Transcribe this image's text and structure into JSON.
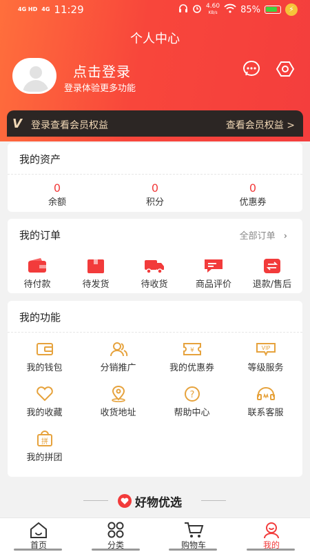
{
  "status_bar": {
    "signal1": "4G HD",
    "signal2": "4G",
    "time": "11:29",
    "net_speed_value": "4.60",
    "net_speed_unit": "KB/s",
    "battery": "85%"
  },
  "header": {
    "title": "个人中心",
    "login_title": "点击登录",
    "login_subtitle": "登录体验更多功能"
  },
  "vip_banner": {
    "logo": "V",
    "text": "登录查看会员权益",
    "link": "查看会员权益 >"
  },
  "assets": {
    "title": "我的资产",
    "items": [
      {
        "value": "0",
        "label": "余额"
      },
      {
        "value": "0",
        "label": "积分"
      },
      {
        "value": "0",
        "label": "优惠券"
      }
    ]
  },
  "orders": {
    "title": "我的订单",
    "all_link": "全部订单",
    "items": [
      {
        "label": "待付款",
        "icon": "wallet-icon"
      },
      {
        "label": "待发货",
        "icon": "package-icon"
      },
      {
        "label": "待收货",
        "icon": "truck-icon"
      },
      {
        "label": "商品评价",
        "icon": "comment-icon"
      },
      {
        "label": "退款/售后",
        "icon": "refund-icon"
      }
    ]
  },
  "functions": {
    "title": "我的功能",
    "items": [
      {
        "label": "我的钱包",
        "icon": "wallet-icon"
      },
      {
        "label": "分销推广",
        "icon": "users-icon"
      },
      {
        "label": "我的优惠券",
        "icon": "coupon-icon"
      },
      {
        "label": "等级服务",
        "icon": "vip-icon"
      },
      {
        "label": "我的收藏",
        "icon": "heart-icon"
      },
      {
        "label": "收货地址",
        "icon": "location-icon"
      },
      {
        "label": "帮助中心",
        "icon": "help-icon"
      },
      {
        "label": "联系客服",
        "icon": "headset-icon"
      },
      {
        "label": "我的拼团",
        "icon": "group-buy-icon"
      }
    ]
  },
  "recommend": {
    "title": "好物优选"
  },
  "tabbar": {
    "items": [
      {
        "label": "首页",
        "icon": "home-icon"
      },
      {
        "label": "分类",
        "icon": "category-icon"
      },
      {
        "label": "购物车",
        "icon": "cart-icon"
      },
      {
        "label": "我的",
        "icon": "profile-icon"
      }
    ],
    "active_index": 3
  },
  "colors": {
    "accent": "#f23b3b",
    "icon_gold": "#e6a23c",
    "header_gradient_start": "#ff6f3c",
    "header_gradient_end": "#f43e3d",
    "vip_bar_bg": "#2c2624",
    "vip_text": "#f1d8b6"
  }
}
